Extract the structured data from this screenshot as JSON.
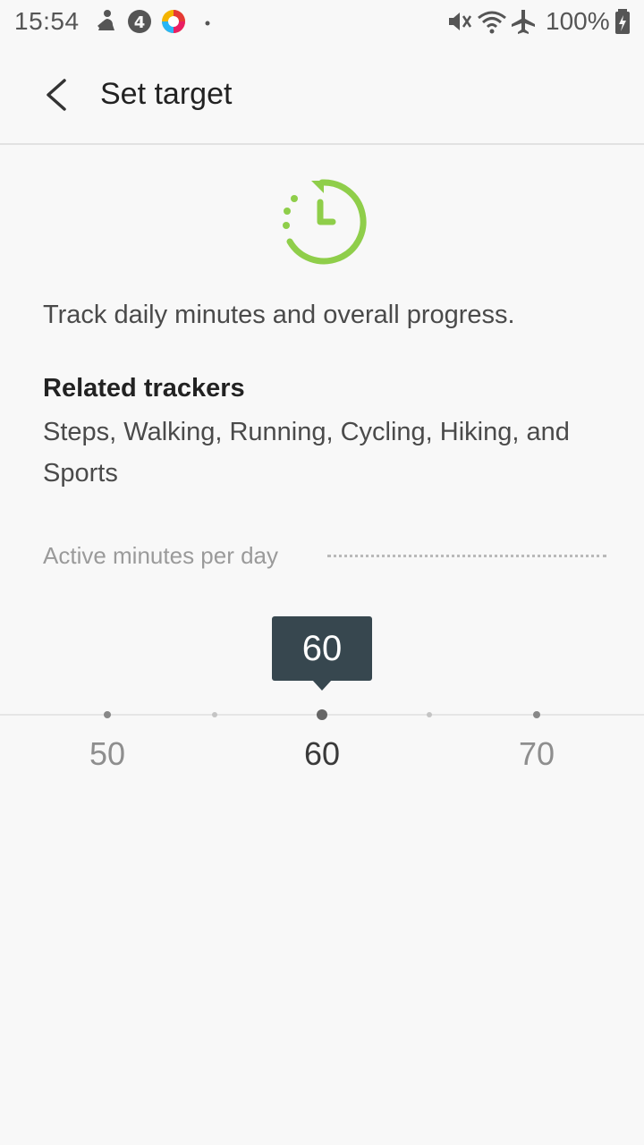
{
  "status_bar": {
    "time": "15:54",
    "left_icons": [
      "pilates-app-icon",
      "notification-4-icon",
      "colorful-app-icon",
      "more-dot-icon"
    ],
    "right_icons": [
      "vibrate-mute-icon",
      "wifi-icon",
      "airplane-mode-icon",
      "battery-charging-icon"
    ],
    "battery": "100%"
  },
  "header": {
    "back_icon": "back-arrow-icon",
    "title": "Set target"
  },
  "hero": {
    "icon": "active-time-timer-icon",
    "accent_color": "#8fce4a"
  },
  "content": {
    "description": "Track daily minutes and overall progress.",
    "related_title": "Related trackers",
    "related_list": "Steps, Walking, Running, Cycling, Hiking, and Sports"
  },
  "picker": {
    "label": "Active minutes per day",
    "selected_value": "60",
    "scale_labels": [
      "50",
      "60",
      "70"
    ],
    "bubble_color": "#37474f"
  }
}
